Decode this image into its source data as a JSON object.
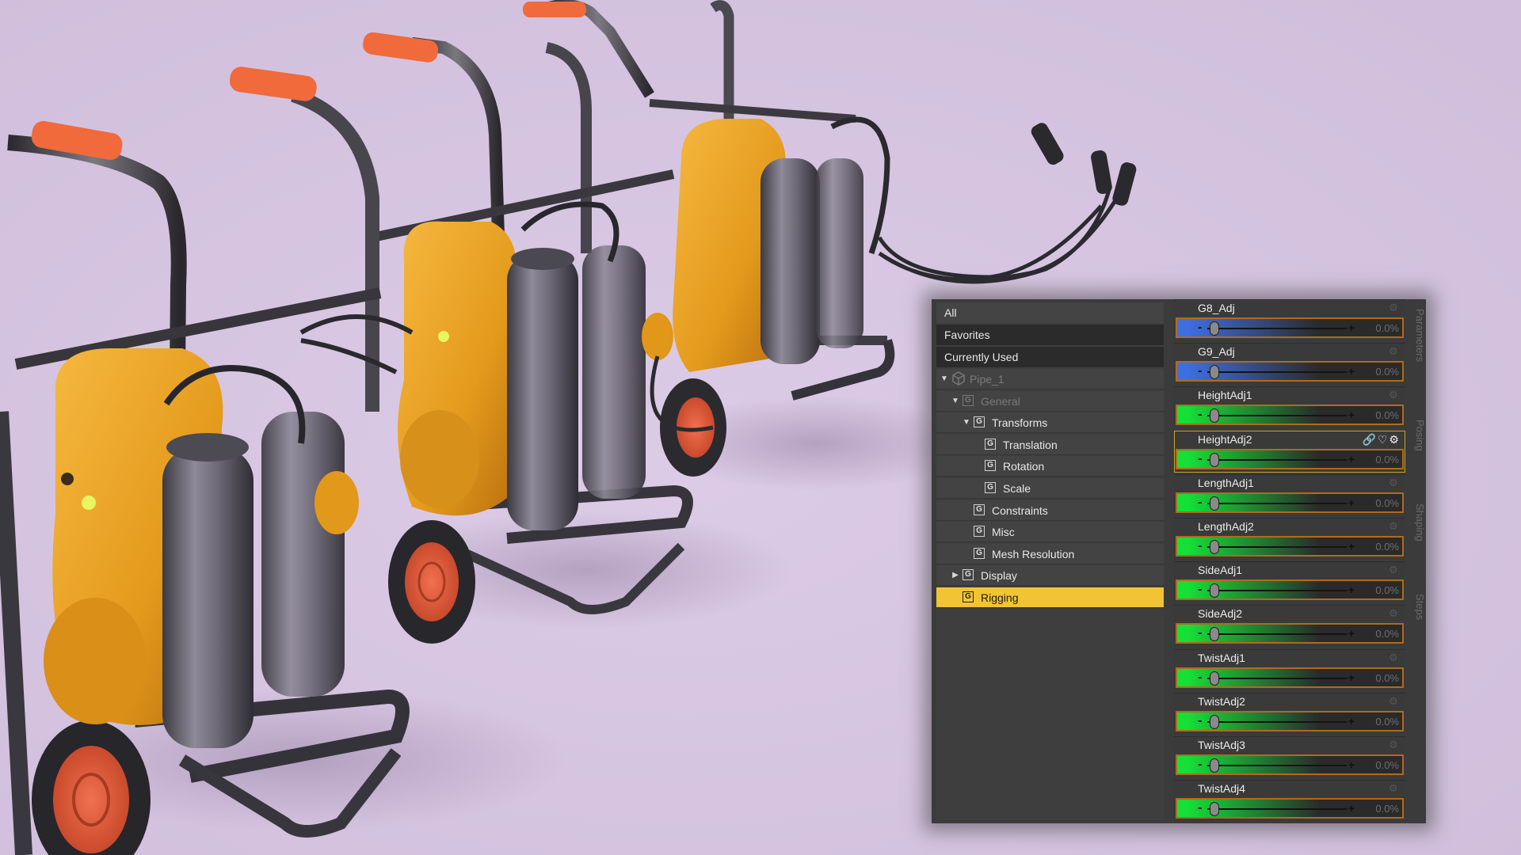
{
  "colors": {
    "background": "#d5c3e1",
    "selection": "#f2c335",
    "slider_blue": "#3e6fe0",
    "slider_green": "#15e038",
    "slider_border": "#b06a1e"
  },
  "scene": {
    "description_icon": "extinguisher-cart-render"
  },
  "panel": {
    "categories": [
      "All",
      "Favorites",
      "Currently Used"
    ],
    "tree": [
      {
        "label": "Pipe_1",
        "level": 0,
        "twisty": "▼",
        "icon": "cube-icon",
        "dim": true
      },
      {
        "label": "General",
        "level": 1,
        "twisty": "▼",
        "icon": "group-icon",
        "dim": true
      },
      {
        "label": "Transforms",
        "level": 2,
        "twisty": "▼",
        "icon": "group-icon"
      },
      {
        "label": "Translation",
        "level": 3,
        "twisty": "",
        "icon": "group-icon"
      },
      {
        "label": "Rotation",
        "level": 3,
        "twisty": "",
        "icon": "group-icon"
      },
      {
        "label": "Scale",
        "level": 3,
        "twisty": "",
        "icon": "group-icon"
      },
      {
        "label": "Constraints",
        "level": 2,
        "twisty": "",
        "icon": "group-icon"
      },
      {
        "label": "Misc",
        "level": 2,
        "twisty": "",
        "icon": "group-icon"
      },
      {
        "label": "Mesh Resolution",
        "level": 2,
        "twisty": "",
        "icon": "group-icon"
      },
      {
        "label": "Display",
        "level": 1,
        "twisty": "▶",
        "icon": "group-icon"
      },
      {
        "label": "Rigging",
        "level": 1,
        "twisty": "",
        "icon": "group-icon",
        "selected": true
      }
    ],
    "group_glyph": "G",
    "parameters": [
      {
        "name": "G8_Adj",
        "value": "0.0%",
        "color": "#3e6fe0"
      },
      {
        "name": "G9_Adj",
        "value": "0.0%",
        "color": "#3e6fe0"
      },
      {
        "name": "HeightAdj1",
        "value": "0.0%",
        "color": "#15e038"
      },
      {
        "name": "HeightAdj2",
        "value": "0.0%",
        "color": "#15e038",
        "focused": true
      },
      {
        "name": "LengthAdj1",
        "value": "0.0%",
        "color": "#15e038"
      },
      {
        "name": "LengthAdj2",
        "value": "0.0%",
        "color": "#15e038"
      },
      {
        "name": "SideAdj1",
        "value": "0.0%",
        "color": "#15e038"
      },
      {
        "name": "SideAdj2",
        "value": "0.0%",
        "color": "#15e038"
      },
      {
        "name": "TwistAdj1",
        "value": "0.0%",
        "color": "#15e038"
      },
      {
        "name": "TwistAdj2",
        "value": "0.0%",
        "color": "#15e038"
      },
      {
        "name": "TwistAdj3",
        "value": "0.0%",
        "color": "#15e038"
      },
      {
        "name": "TwistAdj4",
        "value": "0.0%",
        "color": "#15e038"
      }
    ],
    "slider_minus": "-",
    "slider_plus": "+",
    "focused_icons": "🔗♡⚙",
    "gear_glyph": "⚙",
    "side_tabs": [
      "Parameters",
      "Posing",
      "Shaping",
      "Steps"
    ]
  }
}
